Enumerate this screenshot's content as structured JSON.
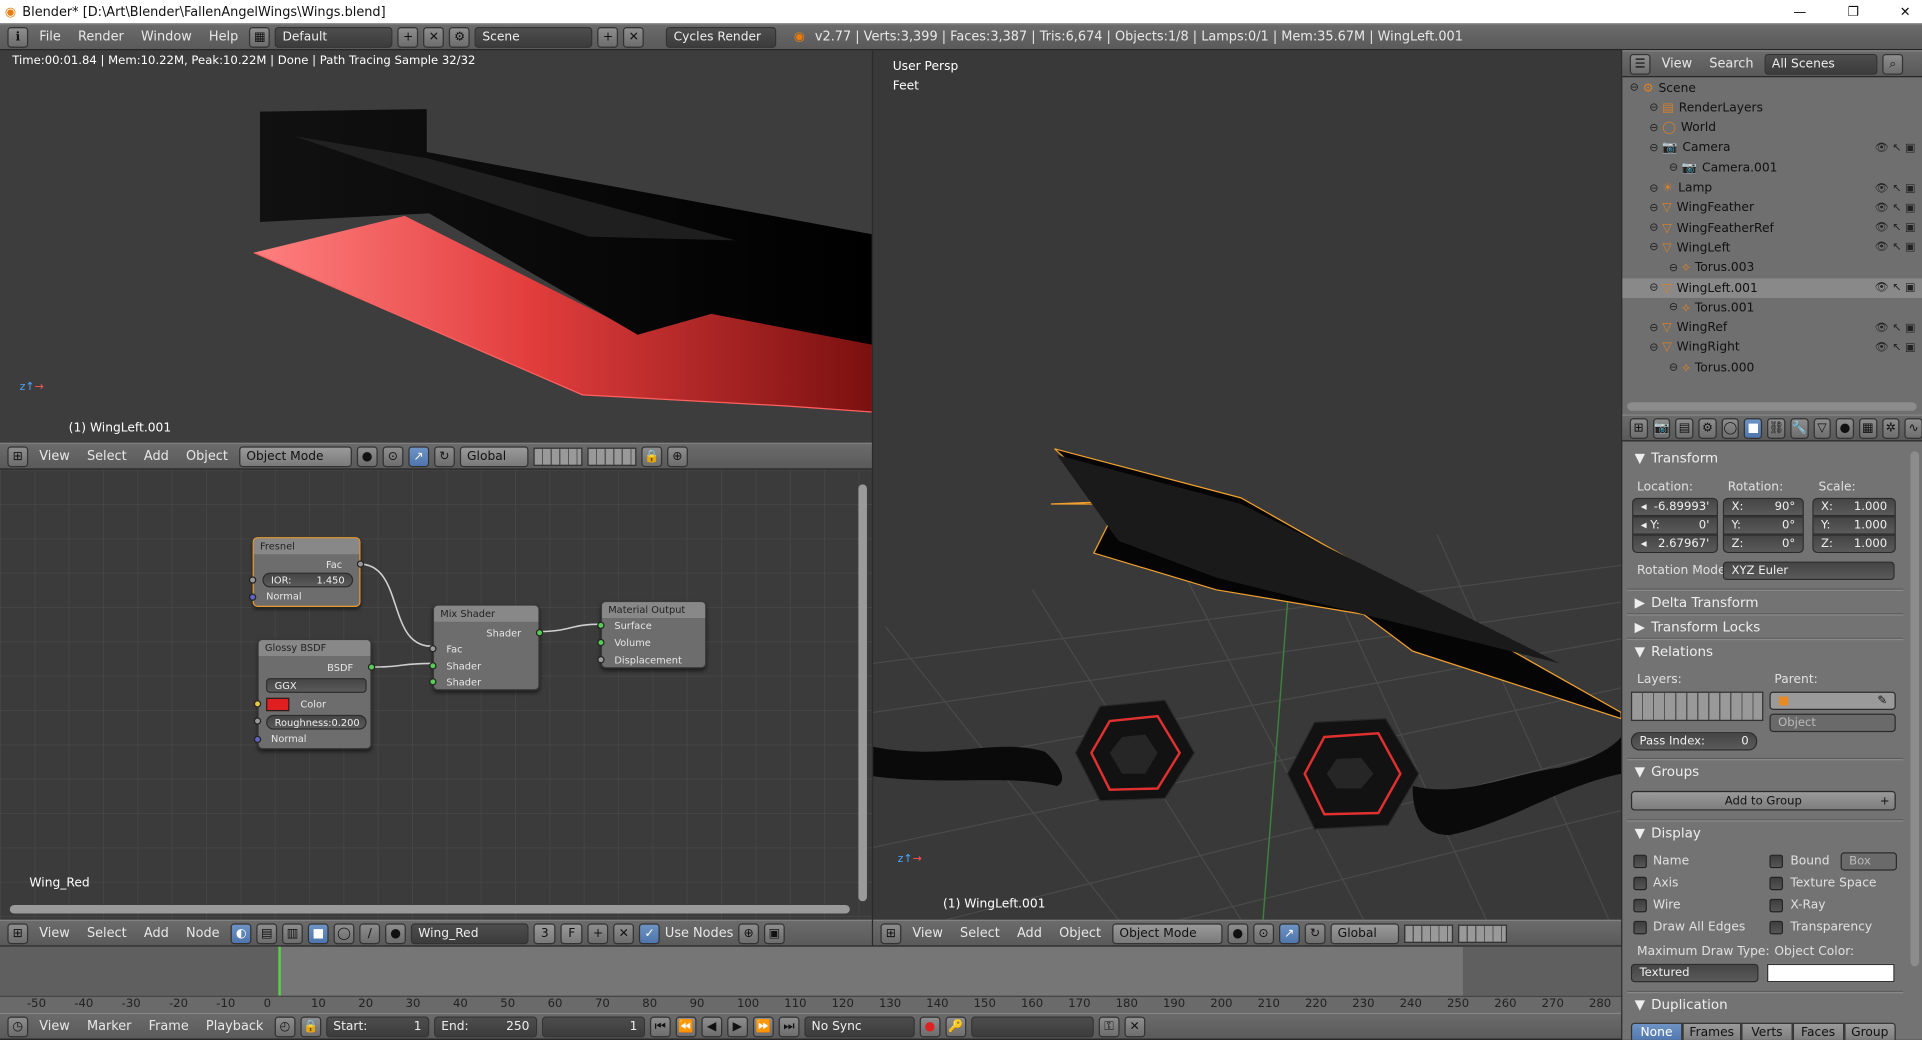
{
  "window": {
    "title": "Blender* [D:\\Art\\Blender\\FallenAngelWings\\Wings.blend]",
    "minimize": "—",
    "maximize": "❐",
    "close": "✕"
  },
  "topbar": {
    "menus": [
      "File",
      "Render",
      "Window",
      "Help"
    ],
    "layout": "Default",
    "scene": "Scene",
    "engine": "Cycles Render",
    "stats": "v2.77 | Verts:3,399 | Faces:3,387 | Tris:6,674 | Objects:1/8 | Lamps:0/1 | Mem:35.67M | WingLeft.001"
  },
  "render_view": {
    "status": "Time:00:01.84 | Mem:10.22M, Peak:10.22M | Done | Path Tracing Sample 32/32",
    "object_label": "(1) WingLeft.001"
  },
  "view3d_header_left": {
    "menus": [
      "View",
      "Select",
      "Add",
      "Object"
    ],
    "mode": "Object Mode",
    "orientation": "Global"
  },
  "node_editor": {
    "material_label": "Wing_Red",
    "header_menus": [
      "View",
      "Select",
      "Add",
      "Node"
    ],
    "material": "Wing_Red",
    "users": "3",
    "fake": "F",
    "use_nodes": "Use Nodes",
    "nodes": {
      "fresnel": {
        "title": "Fresnel",
        "output": "Fac",
        "ior_label": "IOR:",
        "ior": "1.450",
        "input": "Normal"
      },
      "glossy": {
        "title": "Glossy BSDF",
        "output": "BSDF",
        "dist": "GGX",
        "color_label": "Color",
        "rough_label": "Roughness:",
        "rough": "0.200",
        "input": "Normal",
        "color": "#e02020"
      },
      "mix": {
        "title": "Mix Shader",
        "output": "Shader",
        "in1": "Fac",
        "in2": "Shader",
        "in3": "Shader"
      },
      "output": {
        "title": "Material Output",
        "in1": "Surface",
        "in2": "Volume",
        "in3": "Displacement"
      }
    }
  },
  "viewport": {
    "persp": "User Persp",
    "units": "Feet",
    "object_label": "(1) WingLeft.001",
    "menus": [
      "View",
      "Select",
      "Add",
      "Object"
    ],
    "mode": "Object Mode",
    "orientation": "Global"
  },
  "outliner": {
    "view": "View",
    "search": "Search",
    "filter": "All Scenes",
    "items": [
      {
        "label": "Scene",
        "depth": 0
      },
      {
        "label": "RenderLayers",
        "depth": 1
      },
      {
        "label": "World",
        "depth": 1
      },
      {
        "label": "Camera",
        "depth": 1
      },
      {
        "label": "Camera.001",
        "depth": 2
      },
      {
        "label": "Lamp",
        "depth": 1
      },
      {
        "label": "WingFeather",
        "depth": 1
      },
      {
        "label": "WingFeatherRef",
        "depth": 1
      },
      {
        "label": "WingLeft",
        "depth": 1
      },
      {
        "label": "Torus.003",
        "depth": 2
      },
      {
        "label": "WingLeft.001",
        "depth": 1
      },
      {
        "label": "Torus.001",
        "depth": 2
      },
      {
        "label": "WingRef",
        "depth": 1
      },
      {
        "label": "WingRight",
        "depth": 1
      },
      {
        "label": "Torus.000",
        "depth": 2
      }
    ]
  },
  "properties": {
    "transform": {
      "title": "Transform",
      "location": "Location:",
      "rotation": "Rotation:",
      "scale": "Scale:",
      "loc": [
        "-6.89993'",
        "0'",
        "2.67967'"
      ],
      "rot": [
        "90°",
        "0°",
        "0°"
      ],
      "scl": [
        "1.000",
        "1.000",
        "1.000"
      ],
      "axes": [
        "X:",
        "Y:",
        "Z:"
      ],
      "rot_mode_label": "Rotation Mode:",
      "rot_mode": "XYZ Euler"
    },
    "delta": "Delta Transform",
    "locks": "Transform Locks",
    "relations": {
      "title": "Relations",
      "layers": "Layers:",
      "parent": "Parent:",
      "parent_type": "Object",
      "pass_index": "Pass Index:",
      "pass_value": "0"
    },
    "groups": {
      "title": "Groups",
      "add": "Add to Group"
    },
    "display": {
      "title": "Display",
      "left": [
        "Name",
        "Axis",
        "Wire",
        "Draw All Edges"
      ],
      "right": [
        "Bound",
        "Texture Space",
        "X-Ray",
        "Transparency"
      ],
      "bound_type": "Box",
      "max_draw_label": "Maximum Draw Type:",
      "max_draw": "Textured",
      "obj_color_label": "Object Color:"
    },
    "duplication": {
      "title": "Duplication",
      "tabs": [
        "None",
        "Frames",
        "Verts",
        "Faces",
        "Group"
      ]
    }
  },
  "timeline": {
    "ticks": [
      "-50",
      "-40",
      "-30",
      "-20",
      "-10",
      "0",
      "10",
      "20",
      "30",
      "40",
      "50",
      "60",
      "70",
      "80",
      "90",
      "100",
      "110",
      "120",
      "130",
      "140",
      "150",
      "160",
      "170",
      "180",
      "190",
      "200",
      "210",
      "220",
      "230",
      "240",
      "250",
      "260",
      "270",
      "280"
    ],
    "menus": [
      "View",
      "Marker",
      "Frame",
      "Playback"
    ],
    "start_label": "Start:",
    "start": "1",
    "end_label": "End:",
    "end": "250",
    "current": "1",
    "sync": "No Sync"
  }
}
